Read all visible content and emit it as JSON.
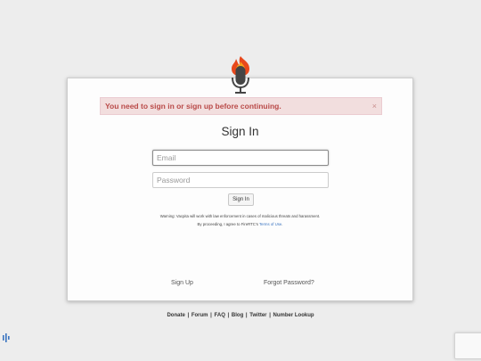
{
  "logo": {
    "icon": "flame-microphone-icon"
  },
  "alert": {
    "message": "You need to sign in or sign up before continuing.",
    "close": "×"
  },
  "form": {
    "title": "Sign In",
    "email_placeholder": "Email",
    "password_placeholder": "Password",
    "submit_label": "Sign In",
    "warning_line1": "Warning: Vacpita will work with law enforcement in cases of malicious threats and harassment.",
    "warning_line2_prefix": "By proceeding, I agree to FireRTC's ",
    "terms_link": "Terms of Use",
    "warning_line2_suffix": "."
  },
  "links": {
    "sign_up": "Sign Up",
    "forgot_password": "Forgot Password?"
  },
  "footer": {
    "items": [
      "Donate",
      "Forum",
      "FAQ",
      "Blog",
      "Twitter",
      "Number Lookup"
    ],
    "separator": "|"
  },
  "colors": {
    "alert_text": "#b94a48",
    "alert_bg": "#f2dede",
    "link": "#3a74c0",
    "flame": "#e8481c"
  }
}
